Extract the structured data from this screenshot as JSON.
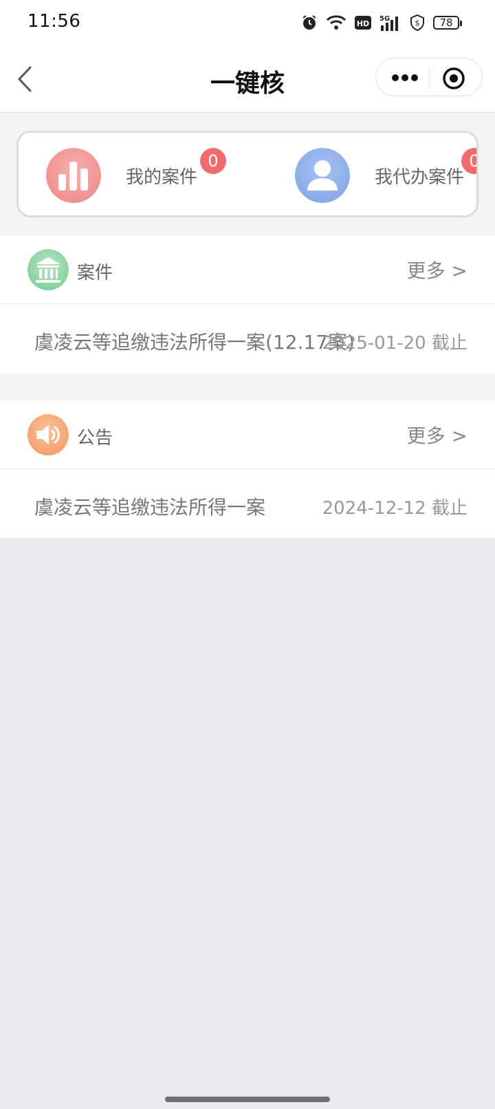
{
  "status_bar": {
    "time": "11:56",
    "battery": "78",
    "icons": [
      "alarm-icon",
      "wifi-icon",
      "hd-icon",
      "5g-signal-icon",
      "shield-icon",
      "battery-icon"
    ]
  },
  "nav": {
    "title": "一键核",
    "back_icon": "chevron-left-icon",
    "more_icon": "more-dots-icon",
    "close_icon": "target-icon"
  },
  "quick": {
    "items": [
      {
        "label": "我的案件",
        "badge": "0",
        "icon": "bar-chart-icon",
        "color": "#f28c8c"
      },
      {
        "label": "我代办案件",
        "badge": "0",
        "icon": "user-icon",
        "color": "#8fb0ea"
      }
    ]
  },
  "sections": {
    "cases": {
      "title": "案件",
      "more": "更多 >",
      "icon": "bank-icon",
      "color": "#8ed4a4",
      "row": {
        "text": "虞凌云等追缴违法所得一案(12.17案)",
        "date": "2025-01-20 截止"
      }
    },
    "notices": {
      "title": "公告",
      "more": "更多 >",
      "icon": "speaker-icon",
      "color": "#f5a878",
      "row": {
        "text": "虞凌云等追缴违法所得一案",
        "date": "2024-12-12 截止"
      }
    }
  }
}
